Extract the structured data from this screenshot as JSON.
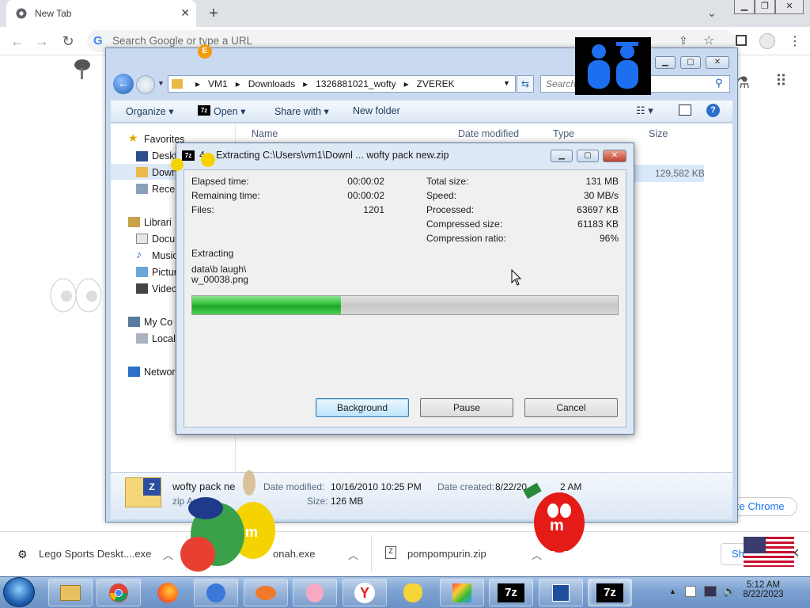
{
  "chrome": {
    "tab_title": "New Tab",
    "omnibox_placeholder": "Search Google or type a URL",
    "customize_label": "ze Chrome"
  },
  "explorer": {
    "breadcrumb": [
      "VM1",
      "Downloads",
      "1326881021_wofty",
      "ZVEREK"
    ],
    "search_placeholder": "Search",
    "commands": {
      "organize": "Organize",
      "open": "Open",
      "share_with": "Share with",
      "new_folder": "New folder"
    },
    "columns": {
      "name": "Name",
      "date_modified": "Date modified",
      "type": "Type",
      "size": "Size"
    },
    "row_size": "129,582 KB",
    "sidebar": {
      "favorites": "Favorites",
      "desktop": "Deskt",
      "downloads": "Down",
      "recent": "Recen",
      "libraries": "Librari",
      "documents": "Docu",
      "music": "Music",
      "pictures": "Pictur",
      "videos": "Video",
      "computer": "My Co",
      "local": "Local",
      "network": "Networ"
    },
    "details": {
      "filename": "wofty pack ne",
      "filetype": "zip Arc",
      "date_modified_label": "Date modified:",
      "date_modified": "10/16/2010 10:25 PM",
      "size_label": "Size:",
      "size": "126 MB",
      "date_created_label": "Date created:",
      "date_created": "8/22/20",
      "date_created_tail": "2 AM"
    }
  },
  "sevenzip": {
    "title": "Extracting C:\\Users\\vm1\\Downl ... wofty pack new.zip",
    "title_prefix": "4",
    "elapsed_label": "Elapsed time:",
    "elapsed": "00:00:02",
    "remaining_label": "Remaining time:",
    "remaining": "00:00:02",
    "files_label": "Files:",
    "files": "1201",
    "total_size_label": "Total size:",
    "total_size": "131 MB",
    "speed_label": "Speed:",
    "speed": "30 MB/s",
    "processed_label": "Processed:",
    "processed": "63697 KB",
    "compressed_label": "Compressed size:",
    "compressed": "61183 KB",
    "ratio_label": "Compression ratio:",
    "ratio": "96%",
    "status": "Extracting",
    "current_file_line1": "data\\b laugh\\",
    "current_file_line2": "w_00038.png",
    "progress_fraction": 0.35,
    "buttons": {
      "background": "Background",
      "pause": "Pause",
      "cancel": "Cancel"
    }
  },
  "downloads": {
    "items": [
      "Lego Sports Deskt....exe",
      "onah.exe",
      "pompompurin.zip"
    ],
    "show_all": "Sh"
  },
  "taskbar": {
    "time": "5:12 AM",
    "date": "8/22/2023",
    "apps": [
      "explorer",
      "chrome",
      "firefox",
      "stitch",
      "fish",
      "piglet",
      "yandex",
      "pikachu",
      "paint",
      "7zip",
      "tool",
      "7zip"
    ],
    "label_7z": "7z",
    "label_yandex": "Y"
  },
  "colors": {
    "accent": "#2fbf3a",
    "explorer_frame": "#c9daf0",
    "dialog_frame": "#dfe9f5",
    "taskbar": "#7ea3d2"
  }
}
